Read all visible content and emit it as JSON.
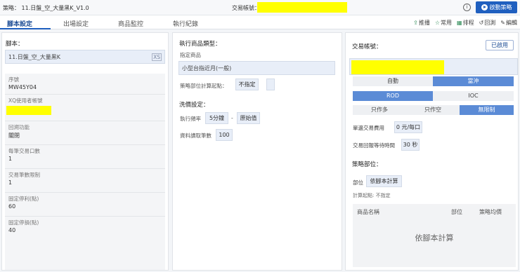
{
  "topbar": {
    "strategy": "策略： 11.日盤_空_大量黑K_V1.0",
    "account_label": "交易帳號：",
    "info_icon": "info-icon",
    "start_button": "啟動策略"
  },
  "tabs": [
    "腳本設定",
    "出場設定",
    "商品監控",
    "執行紀錄"
  ],
  "active_tab": "腳本設定",
  "actions": [
    {
      "icon": "push-icon",
      "label": "推播"
    },
    {
      "icon": "favorite-icon",
      "label": "常用"
    },
    {
      "icon": "schedule-icon",
      "label": "排程"
    },
    {
      "icon": "backtest-icon",
      "label": "回測"
    },
    {
      "icon": "edit-icon",
      "label": "編輯"
    }
  ],
  "script_panel": {
    "title": "腳本：",
    "script_name": "11.日盤_空_大量黑K",
    "script_badge": "XS",
    "rows": [
      {
        "label": "序號",
        "value": "MW45Y04"
      },
      {
        "label": "XQ使用者帳號",
        "value": ""
      },
      {
        "label": "回溯功能",
        "value": "關閉"
      },
      {
        "label": "每筆交易口數",
        "value": "1"
      },
      {
        "label": "交易筆數限制",
        "value": "1"
      },
      {
        "label": "固定停利(點)",
        "value": "60"
      },
      {
        "label": "固定停損(點)",
        "value": "40"
      }
    ]
  },
  "exec_panel": {
    "title": "執行商品類型：",
    "product_label": "指定商品",
    "product_value": "小型台指近月(一般)",
    "calc_start_label": "策略部位計算起點：",
    "calc_start_value": "不指定",
    "wash_title": "洗價設定：",
    "freq_label": "執行頻率",
    "freq_value": "5分鐘",
    "freq_sep": "-",
    "freq_mode": "原始值",
    "bars_label": "資料讀取筆數",
    "bars_value": "100"
  },
  "account_panel": {
    "title": "交易帳號：",
    "enabled_button": "已啟用",
    "mode_options": [
      "自動",
      "當沖"
    ],
    "mode_selected": "當沖",
    "order_types": [
      "ROD",
      "IOC"
    ],
    "order_selected": "ROD",
    "direction_options": [
      "只作多",
      "只作空",
      "無限制"
    ],
    "direction_selected": "無限制",
    "fee_label": "單邊交易費用",
    "fee_value": "0 元/每口",
    "wait_label": "交易回報等待時間",
    "wait_value": "30 秒",
    "position_title": "策略部位：",
    "position_label": "部位",
    "position_value": "依腳本計算",
    "calc_note": "計算起點: 不指定",
    "table_headers": [
      "商品名稱",
      "部位",
      "策略均價"
    ],
    "table_empty": "依腳本計算"
  },
  "colors": {
    "accent": "#1f5fbf",
    "highlight": "#ffff00",
    "segment_on": "#5b8bd6"
  }
}
